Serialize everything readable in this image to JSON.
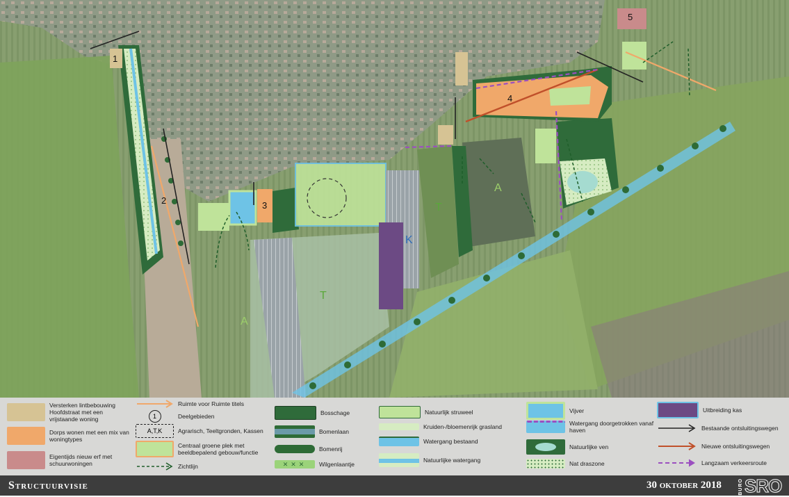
{
  "map": {
    "zones": [
      {
        "id": "1",
        "label": "1"
      },
      {
        "id": "2",
        "label": "2"
      },
      {
        "id": "3",
        "label": "3"
      },
      {
        "id": "4",
        "label": "4"
      },
      {
        "id": "5",
        "label": "5"
      }
    ],
    "areas": [
      {
        "label": "A",
        "color": "#9ccf6a"
      },
      {
        "label": "A",
        "color": "#9ccf6a"
      },
      {
        "label": "T",
        "color": "#5aa83a"
      },
      {
        "label": "T",
        "color": "#5aa83a"
      },
      {
        "label": "K",
        "color": "#2e6db8"
      }
    ]
  },
  "legend": {
    "lint": "Versterken lintbebouwing Hoofdstraat met een vrijstaande woning",
    "dorps": "Dorps wonen met een mix van woningtypes",
    "erf": "Eigentijds nieuw erf met schuurwoningen",
    "ruimte": "Ruimte voor Ruimte titels",
    "deel_symbol": "1",
    "deel": "Deelgebieden",
    "atk_symbol": "A,T,K",
    "atk": "Agrarisch, Teeltgronden, Kassen",
    "centraal": "Centraal groene plek met beeldbepalend gebouw/functie",
    "zicht": "Zichtlijn",
    "bosschage": "Bosschage",
    "bomenlaan": "Bomenlaan",
    "bomenrij": "Bomenrij",
    "wilgen": "Wilgenlaantje",
    "struweel": "Natuurlijk struweel",
    "kruiden": "Kruiden-/bloemenrijk grasland",
    "watergang": "Watergang bestaand",
    "natuurlijke_watergang": "Natuurlijke watergang",
    "vijver": "Vijver",
    "doorgetrokken": "Watergang doorgetrokken vanaf haven",
    "ven": "Natuurlijke ven",
    "draszone": "Nat draszone",
    "kas": "Uitbreiding kas",
    "bestaande": "Bestaande ontsluitingswegen",
    "nieuwe": "Nieuwe ontsluitingswegen",
    "langzaam": "Langzaam verkeersroute"
  },
  "colors": {
    "beige": "#d6c394",
    "orange": "#f0a86a",
    "pink": "#c98b8b",
    "forest": "#2f6b3a",
    "water": "#6ec3e6",
    "meadow": "#bfe39a",
    "purple": "#9b4fc0",
    "newroad": "#c0502a"
  },
  "footer": {
    "title": "Structuurvisie",
    "date": "30 oktober 2018",
    "buro": "BURO",
    "logo": "SRO"
  }
}
